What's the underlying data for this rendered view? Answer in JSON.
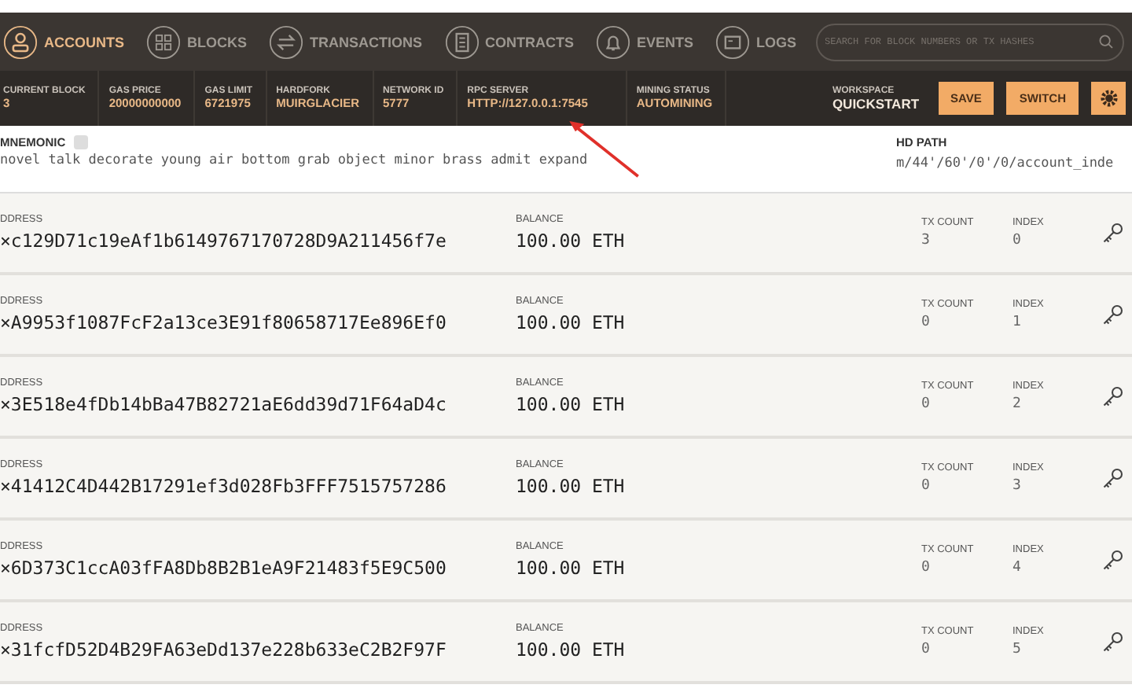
{
  "nav": {
    "tabs": [
      {
        "label": "ACCOUNTS",
        "selected": true
      },
      {
        "label": "BLOCKS",
        "selected": false
      },
      {
        "label": "TRANSACTIONS",
        "selected": false
      },
      {
        "label": "CONTRACTS",
        "selected": false
      },
      {
        "label": "EVENTS",
        "selected": false
      },
      {
        "label": "LOGS",
        "selected": false
      }
    ],
    "search": {
      "placeholder": "SEARCH FOR BLOCK NUMBERS OR TX HASHES"
    }
  },
  "status_bar": {
    "items": [
      {
        "label": "CURRENT BLOCK",
        "value": "3"
      },
      {
        "label": "GAS PRICE",
        "value": "20000000000"
      },
      {
        "label": "GAS LIMIT",
        "value": "6721975"
      },
      {
        "label": "HARDFORK",
        "value": "MUIRGLACIER"
      },
      {
        "label": "NETWORK ID",
        "value": "5777"
      },
      {
        "label": "RPC SERVER",
        "value": "HTTP://127.0.0.1:7545"
      },
      {
        "label": "MINING STATUS",
        "value": "AUTOMINING"
      }
    ],
    "workspace": {
      "label": "WORKSPACE",
      "value": "QUICKSTART"
    },
    "buttons": [
      "SAVE",
      "SWITCH"
    ]
  },
  "mnemonic": {
    "label": "MNEMONIC",
    "value": "novel talk decorate young air bottom grab object minor brass admit expand"
  },
  "hd_path": {
    "label": "HD PATH",
    "value": "m/44'/60'/0'/0/account_inde"
  },
  "accounts": [
    {
      "address_label": "DDRESS",
      "address": "×c129D71c19eAf1b6149767170728D9A211456f7e",
      "balance_label": "BALANCE",
      "balance": "100.00 ETH",
      "tx_label": "TX COUNT",
      "tx_count": "3",
      "index_label": "INDEX",
      "index": "0"
    },
    {
      "address_label": "DDRESS",
      "address": "×A9953f1087FcF2a13ce3E91f80658717Ee896Ef0",
      "balance_label": "BALANCE",
      "balance": "100.00 ETH",
      "tx_label": "TX COUNT",
      "tx_count": "0",
      "index_label": "INDEX",
      "index": "1"
    },
    {
      "address_label": "DDRESS",
      "address": "×3E518e4fDb14bBa47B82721aE6dd39d71F64aD4c",
      "balance_label": "BALANCE",
      "balance": "100.00 ETH",
      "tx_label": "TX COUNT",
      "tx_count": "0",
      "index_label": "INDEX",
      "index": "2"
    },
    {
      "address_label": "DDRESS",
      "address": "×41412C4D442B17291ef3d028Fb3FFF7515757286",
      "balance_label": "BALANCE",
      "balance": "100.00 ETH",
      "tx_label": "TX COUNT",
      "tx_count": "0",
      "index_label": "INDEX",
      "index": "3"
    },
    {
      "address_label": "DDRESS",
      "address": "×6D373C1ccA03fFA8Db8B2B1eA9F21483f5E9C500",
      "balance_label": "BALANCE",
      "balance": "100.00 ETH",
      "tx_label": "TX COUNT",
      "tx_count": "0",
      "index_label": "INDEX",
      "index": "4"
    },
    {
      "address_label": "DDRESS",
      "address": "×31fcfD52D4B29FA63eDd137e228b633eC2B2F97F",
      "balance_label": "BALANCE",
      "balance": "100.00 ETH",
      "tx_label": "TX COUNT",
      "tx_count": "0",
      "index_label": "INDEX",
      "index": "5"
    }
  ]
}
